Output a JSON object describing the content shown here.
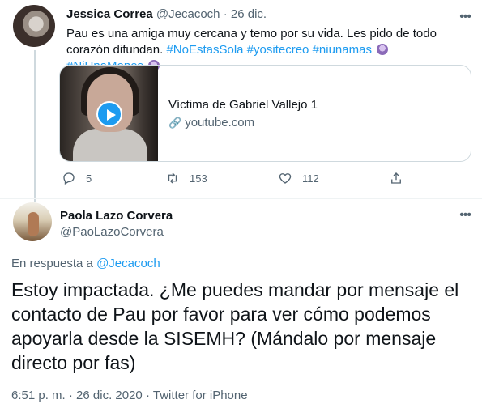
{
  "tweet1": {
    "author_name": "Jessica Correa",
    "handle": "@Jecacoch",
    "separator": "·",
    "date": "26 dic.",
    "more_icon": "more-dots-icon",
    "text_before": "Pau es una amiga muy cercana y temo por su vida. Les pido de todo corazón difundan.",
    "hashtags": [
      "#NoEstasSola",
      "#yositecreo",
      "#niunamas",
      "#NiUnaMenos"
    ],
    "card": {
      "title": "Víctima de Gabriel Vallejo 1",
      "domain": "youtube.com",
      "link_icon": "link-icon"
    },
    "actions": {
      "replies": "5",
      "retweets": "153",
      "likes": "112"
    }
  },
  "tweet2": {
    "author_name": "Paola Lazo Corvera",
    "handle": "@PaoLazoCorvera",
    "reply_prefix": "En respuesta a",
    "reply_handle": "@Jecacoch",
    "text": "Estoy impactada. ¿Me puedes mandar por mensaje el contacto de Pau por favor para ver cómo podemos apoyarla desde la SISEMH? (Mándalo por mensaje directo por fas)",
    "time": "6:51 p. m.",
    "separator": "·",
    "date": "26 dic. 2020",
    "separator2": "·",
    "source": "Twitter for iPhone"
  },
  "colors": {
    "link": "#1d9bf0",
    "muted": "#536471",
    "text": "#0f1419",
    "border": "#cfd9de"
  }
}
